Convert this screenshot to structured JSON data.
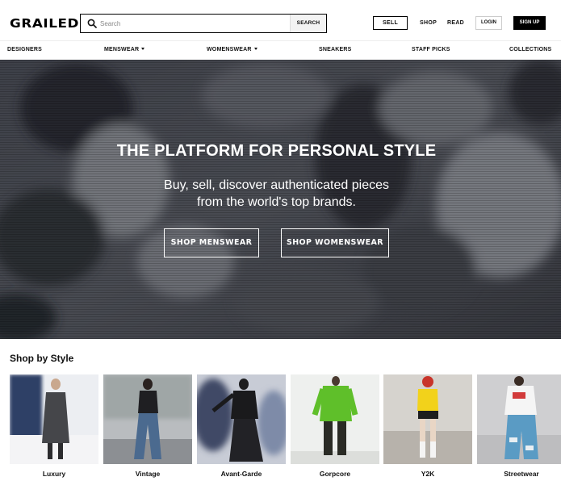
{
  "header": {
    "logo": "GRAILED",
    "search_placeholder": "Search",
    "search_button": "SEARCH",
    "sell": "SELL",
    "shop": "SHOP",
    "read": "READ",
    "login": "LOGIN",
    "signup": "SIGN UP"
  },
  "nav": {
    "designers": "DESIGNERS",
    "menswear": "MENSWEAR",
    "womenswear": "WOMENSWEAR",
    "sneakers": "SNEAKERS",
    "staff_picks": "STAFF PICKS",
    "collections": "COLLECTIONS"
  },
  "hero": {
    "title": "THE PLATFORM FOR PERSONAL STYLE",
    "subtitle_line1": "Buy, sell, discover authenticated pieces",
    "subtitle_line2": "from the world's top brands.",
    "shop_menswear": "SHOP MENSWEAR",
    "shop_womenswear": "SHOP WOMENSWEAR"
  },
  "styles": {
    "title": "Shop by Style",
    "items": [
      {
        "label": "Luxury"
      },
      {
        "label": "Vintage"
      },
      {
        "label": "Avant-Garde"
      },
      {
        "label": "Gorpcore"
      },
      {
        "label": "Y2K"
      },
      {
        "label": "Streetwear"
      }
    ]
  },
  "colors": {
    "brand_black": "#000000",
    "hero_overlay": "#3b3d45",
    "text": "#111111"
  }
}
